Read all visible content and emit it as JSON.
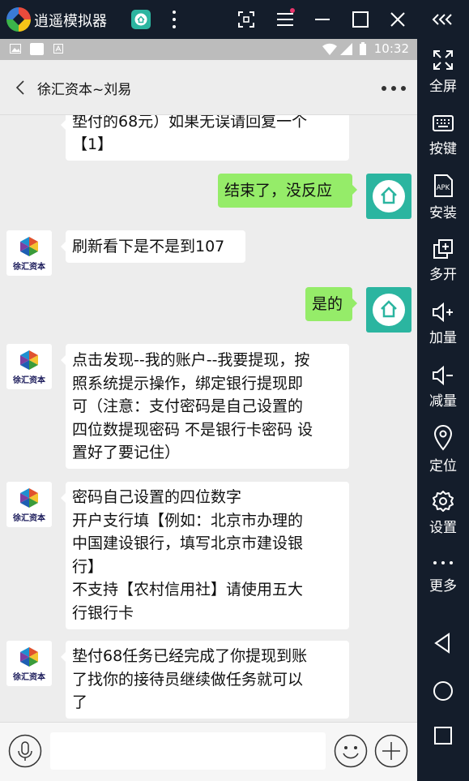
{
  "emulator": {
    "title": "逍遥模拟器",
    "sidebar": [
      {
        "label": "全屏",
        "icon": "fullscreen-icon"
      },
      {
        "label": "按键",
        "icon": "keyboard-icon"
      },
      {
        "label": "安装",
        "icon": "apk-icon"
      },
      {
        "label": "多开",
        "icon": "multi-instance-icon"
      },
      {
        "label": "加量",
        "icon": "volume-up-icon"
      },
      {
        "label": "减量",
        "icon": "volume-down-icon"
      },
      {
        "label": "定位",
        "icon": "location-icon"
      },
      {
        "label": "设置",
        "icon": "gear-icon"
      },
      {
        "label": "更多",
        "icon": "more-icon"
      }
    ],
    "apk_text": "APK",
    "accent_color": "#2bb5a0"
  },
  "status_bar": {
    "time": "10:32"
  },
  "chat": {
    "title": "徐汇资本~刘易",
    "contact_avatar_text": "徐汇资本",
    "messages": [
      {
        "side": "left",
        "lines": [
          "垫付的68元）如果无误请回复一个",
          "【1】"
        ]
      },
      {
        "side": "right",
        "lines": [
          "结束了，没反应"
        ]
      },
      {
        "side": "left",
        "lines": [
          "刷新看下是不是到107"
        ]
      },
      {
        "side": "right",
        "lines": [
          "是的"
        ]
      },
      {
        "side": "left",
        "lines": [
          "点击发现--我的账户--我要提现，按",
          "照系统提示操作，绑定银行提现即",
          "可（注意：支付密码是自己设置的",
          "四位数提现密码 不是银行卡密码 设",
          "置好了要记住）"
        ]
      },
      {
        "side": "left",
        "lines": [
          "密码自己设置的四位数字",
          "开户支行填【例如：北京市办理的",
          "中国建设银行，填写北京市建设银",
          "行】",
          "不支持【农村信用社】请使用五大",
          "行银行卡"
        ]
      },
      {
        "side": "left",
        "lines": [
          "垫付68任务已经完成了你提现到账",
          "了找你的接待员继续做任务就可以",
          "了"
        ]
      }
    ]
  }
}
